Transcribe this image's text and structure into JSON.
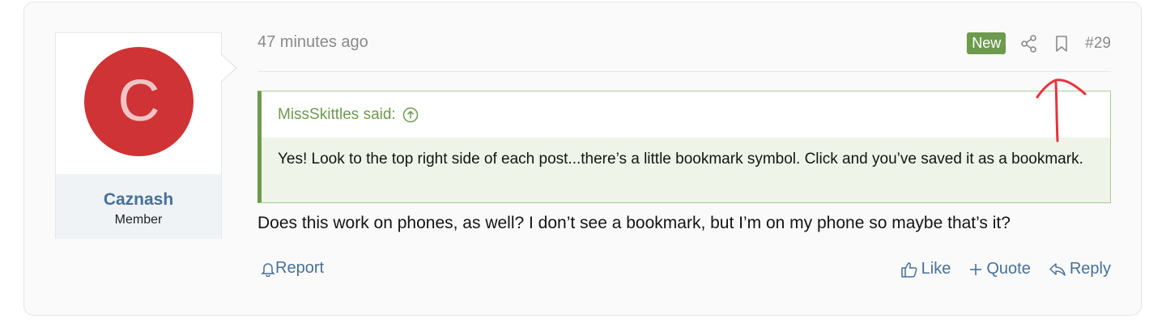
{
  "post": {
    "user": {
      "avatar_letter": "C",
      "avatar_color": "#cf3336",
      "username": "Caznash",
      "title": "Member"
    },
    "meta": {
      "time": "47 minutes ago",
      "badge": "New",
      "share_icon": "share-icon",
      "bookmark_icon": "bookmark-icon",
      "post_number": "#29"
    },
    "quote": {
      "author_line": "MissSkittles said:",
      "expand_icon": "arrow-up-circle-icon",
      "text": "Yes! Look to the top right side of each post...there’s a little bookmark symbol. Click and you’ve saved it as a bookmark."
    },
    "message": "Does this work on phones, as well? I don’t see a bookmark, but I’m on my phone so maybe that’s it?",
    "actions": {
      "report": "Report",
      "like": "Like",
      "quote": "Quote",
      "reply": "Reply"
    },
    "colors": {
      "accent": "#47709a",
      "quote_green": "#6d9a4d",
      "annotation_red": "#e8323c"
    }
  }
}
